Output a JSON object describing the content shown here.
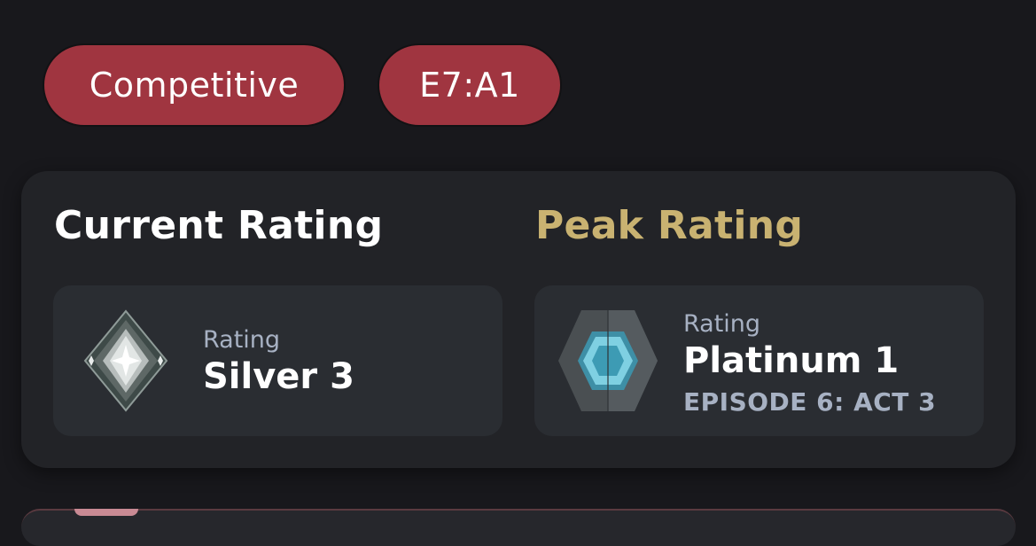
{
  "filters": {
    "mode_label": "Competitive",
    "act_label": "E7:A1",
    "accent_color": "#a03540"
  },
  "current": {
    "title": "Current Rating",
    "label": "Rating",
    "value": "Silver 3",
    "icon": "silver-rank-icon"
  },
  "peak": {
    "title": "Peak Rating",
    "title_color": "#c9b271",
    "label": "Rating",
    "value": "Platinum 1",
    "sub": "EPISODE 6: ACT 3",
    "icon": "platinum-rank-icon"
  }
}
